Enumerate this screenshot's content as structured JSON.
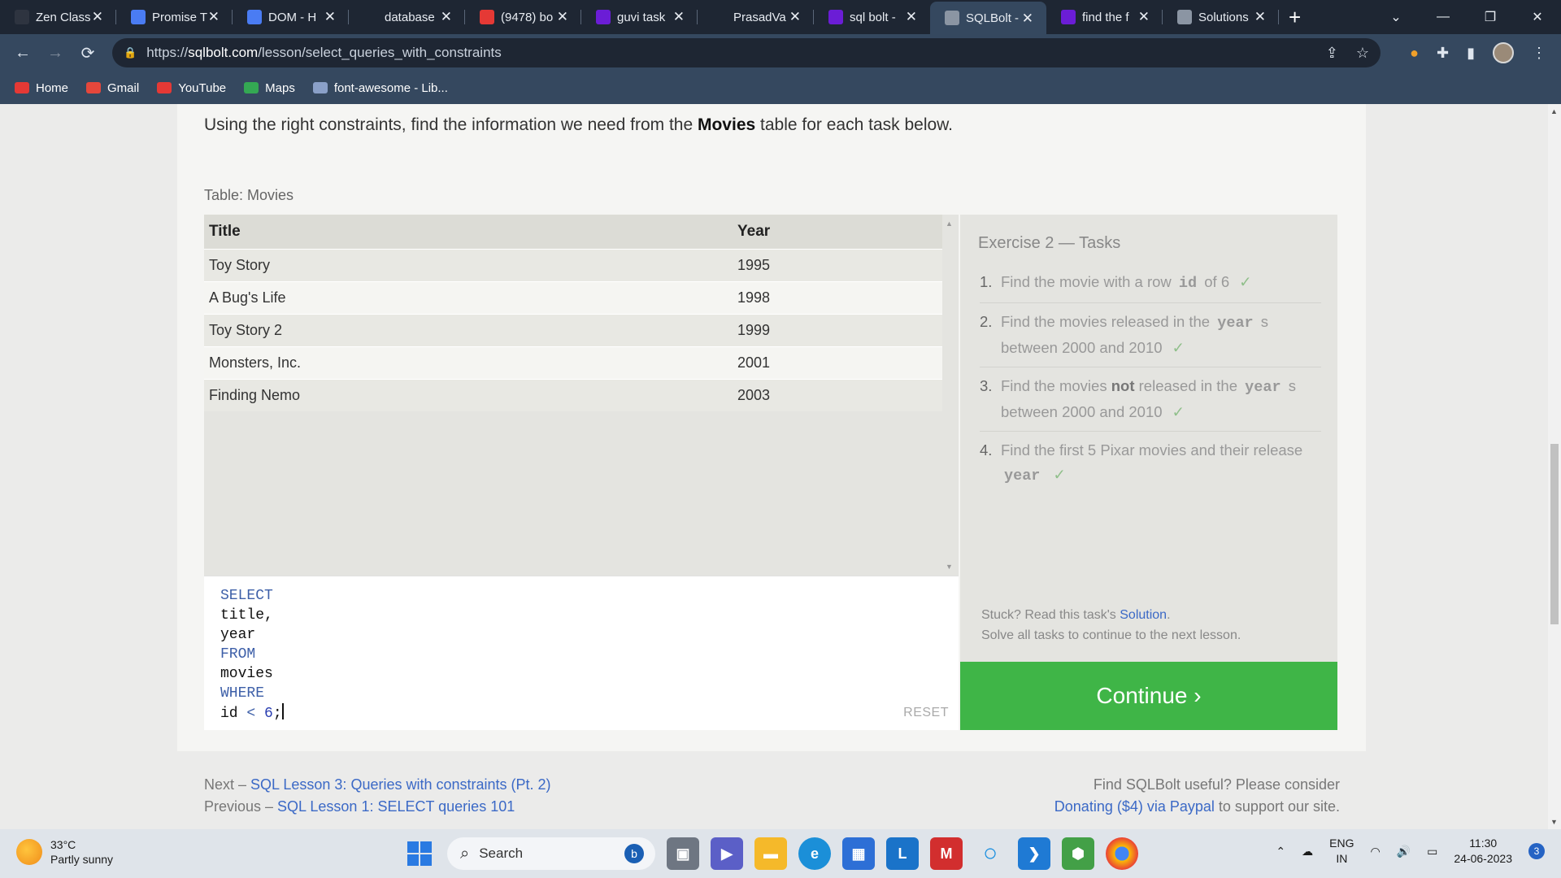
{
  "browser": {
    "tabs": [
      {
        "title": "Zen Class",
        "icon": "zen-icon",
        "color": "#2e3440"
      },
      {
        "title": "Promise T",
        "icon": "docs-icon",
        "color": "#4a7cf3"
      },
      {
        "title": "DOM - H",
        "icon": "docs-icon",
        "color": "#4a7cf3"
      },
      {
        "title": "database",
        "icon": "github-icon",
        "color": "#1e2633"
      },
      {
        "title": "(9478) bo",
        "icon": "youtube-icon",
        "color": "#e53935"
      },
      {
        "title": "guvi task",
        "icon": "yahoo-icon",
        "color": "#6b1dd6"
      },
      {
        "title": "PrasadVa",
        "icon": "github-icon",
        "color": "#1e2633"
      },
      {
        "title": "sql bolt -",
        "icon": "yahoo-icon",
        "color": "#6b1dd6"
      },
      {
        "title": "SQLBolt -",
        "icon": "database-icon",
        "color": "#8b95a3"
      },
      {
        "title": "find the f",
        "icon": "yahoo-icon",
        "color": "#6b1dd6"
      },
      {
        "title": "Solutions",
        "icon": "globe-icon",
        "color": "#8b95a3"
      }
    ],
    "active_tab_index": 8,
    "url_domain": "sqlbolt.com",
    "url_prefix": "https://",
    "url_path": "/lesson/select_queries_with_constraints",
    "bookmarks": [
      {
        "label": "Home",
        "icon": "youtube-icon",
        "color": "#e53935"
      },
      {
        "label": "Gmail",
        "icon": "gmail-icon",
        "color": "#e5473b"
      },
      {
        "label": "YouTube",
        "icon": "youtube-icon",
        "color": "#e53935"
      },
      {
        "label": "Maps",
        "icon": "maps-icon",
        "color": "#34a853"
      },
      {
        "label": "font-awesome - Lib...",
        "icon": "code-icon",
        "color": "#8aa0c8"
      }
    ]
  },
  "lesson": {
    "intro_prefix": "Using the right constraints, find the information we need from the ",
    "intro_bold": "Movies",
    "intro_suffix": " table for each task below.",
    "table_label": "Table: Movies",
    "columns": [
      "Title",
      "Year"
    ],
    "rows": [
      [
        "Toy Story",
        "1995"
      ],
      [
        "A Bug's Life",
        "1998"
      ],
      [
        "Toy Story 2",
        "1999"
      ],
      [
        "Monsters, Inc.",
        "2001"
      ],
      [
        "Finding Nemo",
        "2003"
      ]
    ],
    "query_lines": [
      "SELECT",
      "title,",
      "year",
      "FROM",
      "movies",
      "WHERE"
    ],
    "query_last": {
      "ident": "id",
      "op": "<",
      "num": "6",
      "end": ";"
    },
    "reset_label": "RESET",
    "exercise_title": "Exercise 2 — Tasks",
    "tasks": [
      {
        "num": "1.",
        "pre": "Find the movie with a row ",
        "code": "id",
        "post": " of 6",
        "check": "✓"
      },
      {
        "num": "2.",
        "pre": "Find the movies released in the ",
        "code": "year",
        "post": " s between 2000 and 2010",
        "check": "✓"
      },
      {
        "num": "3.",
        "pre": "Find the movies ",
        "bold": "not",
        "pre2": " released in the ",
        "code": "year",
        "post": " s between 2000 and 2010",
        "check": "✓"
      },
      {
        "num": "4.",
        "pre": "Find the first 5 Pixar movies and their release ",
        "code": "year",
        "post": "",
        "check": "✓"
      }
    ],
    "stuck_prefix": "Stuck? Read this task's ",
    "stuck_link": "Solution",
    "stuck_suffix": ".",
    "solve_all": "Solve all tasks to continue to the next lesson.",
    "continue_label": "Continue ›",
    "next_prefix": "Next – ",
    "next_link": "SQL Lesson 3: Queries with constraints (Pt. 2)",
    "prev_prefix": "Previous – ",
    "prev_link": "SQL Lesson 1: SELECT queries 101",
    "support_text": "Find SQLBolt useful? Please consider",
    "donate_link": "Donating ($4) via Paypal",
    "support_suffix": " to support our site."
  },
  "taskbar": {
    "temperature": "33°C",
    "weather": "Partly sunny",
    "search_label": "Search",
    "lang": "ENG",
    "region": "IN",
    "time": "11:30",
    "date": "24-06-2023",
    "notifications": "3"
  },
  "colors": {
    "accent_green": "#3fb547",
    "link_blue": "#3b69c6",
    "chrome_dark": "#1e2633",
    "chrome_mid": "#35485f"
  }
}
